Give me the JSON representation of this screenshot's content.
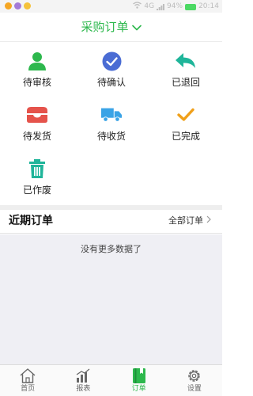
{
  "colors": {
    "accent": "#2db84d",
    "blue": "#4a6cd4",
    "teal": "#1fb59a",
    "red": "#e5534b",
    "sky": "#3aa3e6",
    "orange": "#f0a01a",
    "icon_gray": "#666666",
    "status_dots": [
      "#f5a623",
      "#a57bd8",
      "#f5c23a"
    ],
    "battery": "#4cd964"
  },
  "status_bar": {
    "carrier": "4G",
    "battery_text": "94%",
    "time": "20:14"
  },
  "header": {
    "title": "采购订单",
    "dropdown_icon": "chevron-down-icon"
  },
  "grid": {
    "items": [
      {
        "label": "待审核",
        "icon": "user-icon"
      },
      {
        "label": "待确认",
        "icon": "check-circle-icon"
      },
      {
        "label": "已退回",
        "icon": "reply-arrow-icon"
      },
      {
        "label": "待发货",
        "icon": "inbox-tray-icon"
      },
      {
        "label": "待收货",
        "icon": "truck-icon"
      },
      {
        "label": "已完成",
        "icon": "checkmark-icon"
      },
      {
        "label": "已作废",
        "icon": "trash-icon"
      }
    ]
  },
  "recent": {
    "title": "近期订单",
    "all_label": "全部订单"
  },
  "empty": {
    "message": "没有更多数据了"
  },
  "tabbar": {
    "tabs": [
      {
        "label": "首页",
        "icon": "home-icon",
        "active": false
      },
      {
        "label": "报表",
        "icon": "chart-icon",
        "active": false
      },
      {
        "label": "订单",
        "icon": "book-icon",
        "active": true
      },
      {
        "label": "设置",
        "icon": "gear-icon",
        "active": false
      }
    ]
  }
}
